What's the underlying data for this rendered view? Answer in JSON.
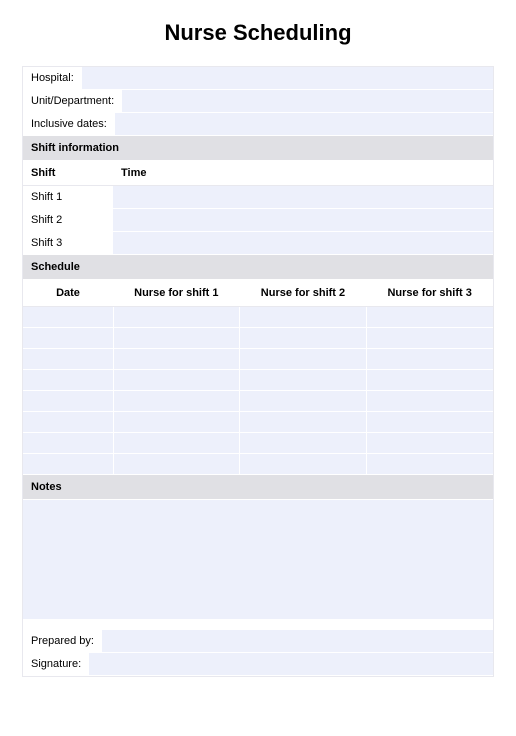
{
  "title": "Nurse Scheduling",
  "fields": {
    "hospital_label": "Hospital:",
    "hospital_value": "",
    "unit_label": "Unit/Department:",
    "unit_value": "",
    "dates_label": "Inclusive dates:",
    "dates_value": ""
  },
  "sections": {
    "shift_info": "Shift information",
    "schedule": "Schedule",
    "notes": "Notes"
  },
  "shift_headers": {
    "shift": "Shift",
    "time": "Time"
  },
  "shifts": [
    {
      "name": "Shift 1",
      "time": ""
    },
    {
      "name": "Shift 2",
      "time": ""
    },
    {
      "name": "Shift 3",
      "time": ""
    }
  ],
  "schedule_headers": {
    "date": "Date",
    "nurse1": "Nurse for shift 1",
    "nurse2": "Nurse for shift 2",
    "nurse3": "Nurse for shift 3"
  },
  "schedule_rows": [
    {
      "date": "",
      "n1": "",
      "n2": "",
      "n3": ""
    },
    {
      "date": "",
      "n1": "",
      "n2": "",
      "n3": ""
    },
    {
      "date": "",
      "n1": "",
      "n2": "",
      "n3": ""
    },
    {
      "date": "",
      "n1": "",
      "n2": "",
      "n3": ""
    },
    {
      "date": "",
      "n1": "",
      "n2": "",
      "n3": ""
    },
    {
      "date": "",
      "n1": "",
      "n2": "",
      "n3": ""
    },
    {
      "date": "",
      "n1": "",
      "n2": "",
      "n3": ""
    },
    {
      "date": "",
      "n1": "",
      "n2": "",
      "n3": ""
    }
  ],
  "footer": {
    "prepared_label": "Prepared by:",
    "prepared_value": "",
    "signature_label": "Signature:",
    "signature_value": ""
  }
}
